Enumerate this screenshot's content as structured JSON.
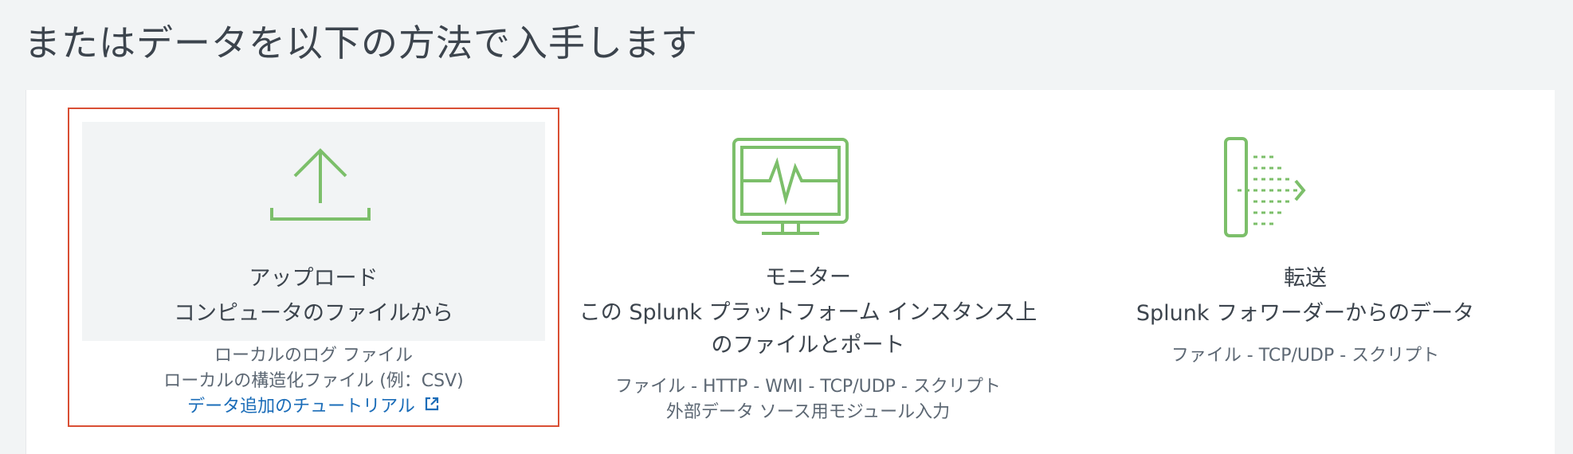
{
  "page": {
    "title": "またはデータを以下の方法で入手します"
  },
  "options": {
    "upload": {
      "icon": "upload-icon",
      "title_line1": "アップロード",
      "title_line2": "コンピュータのファイルから",
      "desc_line1": "ローカルのログ ファイル",
      "desc_line2": "ローカルの構造化ファイル (例：CSV)",
      "link_label": "データ追加のチュートリアル",
      "link_icon": "external-link-icon",
      "selected": true
    },
    "monitor": {
      "icon": "monitor-icon",
      "title_line1": "モニター",
      "title_line2": "この Splunk プラットフォーム インスタンス上",
      "title_line3": "のファイルとポート",
      "desc_line1": "ファイル - HTTP - WMI - TCP/UDP - スクリプト",
      "desc_line2": "外部データ ソース用モジュール入力"
    },
    "forward": {
      "icon": "forwarder-icon",
      "title_line1": "転送",
      "title_line2": "Splunk フォワーダーからのデータ",
      "desc_line1": "ファイル - TCP/UDP - スクリプト"
    }
  },
  "colors": {
    "icon_green": "#7cbf6a",
    "selection_border": "#d94f34",
    "link": "#1a6cb8",
    "background": "#f2f4f5"
  }
}
